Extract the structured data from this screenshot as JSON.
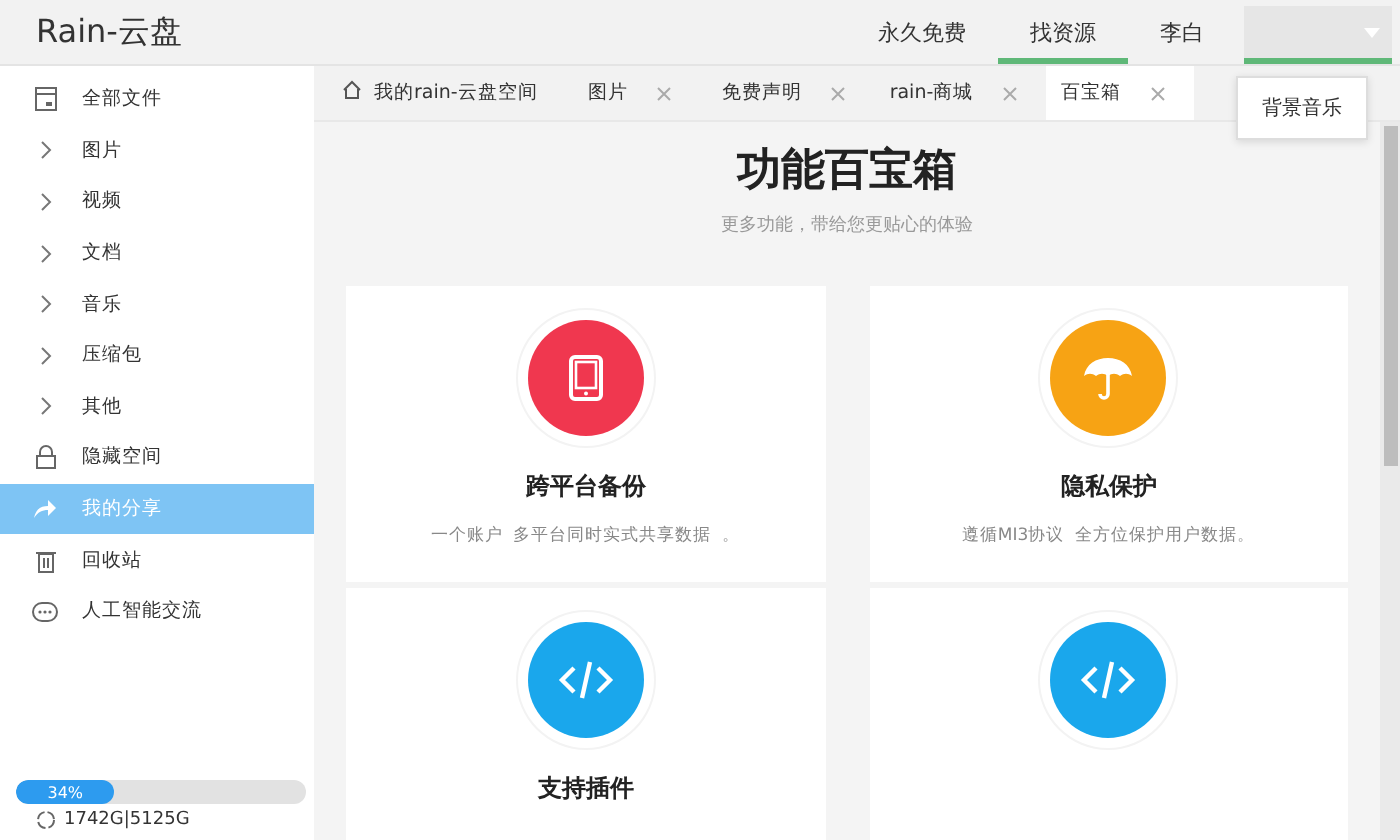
{
  "app": {
    "title": "Rain-云盘"
  },
  "nav": [
    {
      "label": "永久免费",
      "selected": false
    },
    {
      "label": "找资源",
      "selected": true
    },
    {
      "label": "李白",
      "selected": false
    }
  ],
  "user_menu": {
    "expanded": true,
    "items": [
      "背景音乐"
    ]
  },
  "sidebar": {
    "items": [
      {
        "label": "全部文件",
        "kind": "file",
        "selected": false
      },
      {
        "label": "图片",
        "kind": "folder",
        "selected": false
      },
      {
        "label": "视频",
        "kind": "folder",
        "selected": false
      },
      {
        "label": "文档",
        "kind": "folder",
        "selected": false
      },
      {
        "label": "音乐",
        "kind": "folder",
        "selected": false
      },
      {
        "label": "压缩包",
        "kind": "folder",
        "selected": false
      },
      {
        "label": "其他",
        "kind": "folder",
        "selected": false
      },
      {
        "label": "隐藏空间",
        "kind": "lock",
        "selected": false
      },
      {
        "label": "我的分享",
        "kind": "share",
        "selected": true
      },
      {
        "label": "回收站",
        "kind": "trash",
        "selected": false
      },
      {
        "label": "人工智能交流",
        "kind": "chat",
        "selected": false
      }
    ]
  },
  "storage": {
    "level": 0.34,
    "percent": "34%",
    "usage": "1742G|5125G"
  },
  "tabs": [
    {
      "label": "我的rain-云盘空间",
      "kind": "home",
      "selected": false
    },
    {
      "label": "图片",
      "kind": "closable",
      "selected": false
    },
    {
      "label": "免费声明",
      "kind": "closable",
      "selected": false
    },
    {
      "label": "rain-商城",
      "kind": "closable",
      "selected": false
    },
    {
      "label": "百宝箱",
      "kind": "closable",
      "selected": true
    }
  ],
  "heading": {
    "title": "功能百宝箱",
    "subtitle": "更多功能，带给您更贴心的体验"
  },
  "cards": [
    {
      "kind": "tablet",
      "color": "#f0374f",
      "title": "跨平台备份",
      "description": "一个账户  多平台同时实式共享数据  。"
    },
    {
      "kind": "umbrella",
      "color": "#f7a314",
      "title": "隐私保护",
      "description": "遵循MI3协议  全方位保护用户数据。"
    },
    {
      "kind": "code",
      "color": "#1aa7ec",
      "title": "支持插件"
    },
    {
      "kind": "code",
      "color": "#1aa7ec"
    }
  ]
}
